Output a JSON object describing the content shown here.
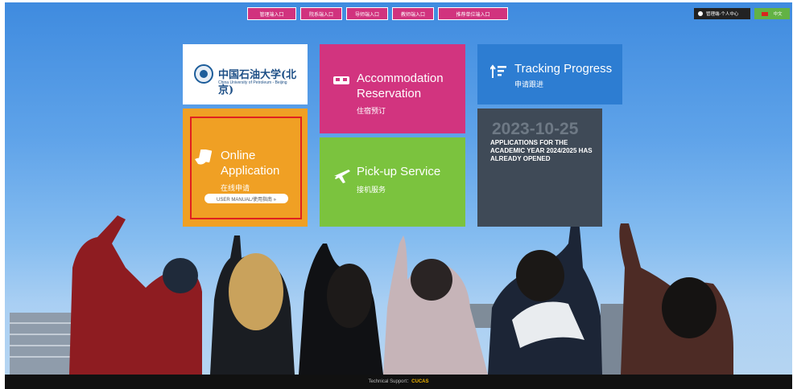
{
  "topnav": {
    "items": [
      {
        "label": "管理端入口"
      },
      {
        "label": "院系端入口"
      },
      {
        "label": "导师端入口"
      },
      {
        "label": "教师端入口"
      },
      {
        "label": "推荐单位端入口"
      }
    ]
  },
  "user": {
    "label": "管理端-个人中心"
  },
  "lang": {
    "label": "中文"
  },
  "logo": {
    "cn": "中国石油大学(北京)",
    "en": "China University of Petroleum - Beijing"
  },
  "tiles": {
    "accommodation": {
      "title": "Accommodation Reservation",
      "sub": "住宿预订",
      "icon": "bed-icon"
    },
    "tracking": {
      "title": "Tracking Progress",
      "sub": "申请跟进",
      "icon": "sort-arrows-icon"
    },
    "online": {
      "title": "Online Application",
      "sub": "在线申请",
      "manual": "USER MANUAL/使用指南 »",
      "icon": "document-hand-icon"
    },
    "pickup": {
      "title": "Pick-up Service",
      "sub": "接机服务",
      "icon": "airplane-icon"
    },
    "notice": {
      "date": "2023-10-25",
      "message": "APPLICATIONS FOR THE ACADEMIC YEAR 2024/2025 HAS ALREADY OPENED"
    }
  },
  "footer": {
    "label": "Technical Support：",
    "brand": "CUCAS"
  },
  "colors": {
    "magenta": "#d2347f",
    "blue": "#2d7dd2",
    "orange": "#f0a024",
    "green": "#7bc33e",
    "slate": "#3f4a57"
  }
}
